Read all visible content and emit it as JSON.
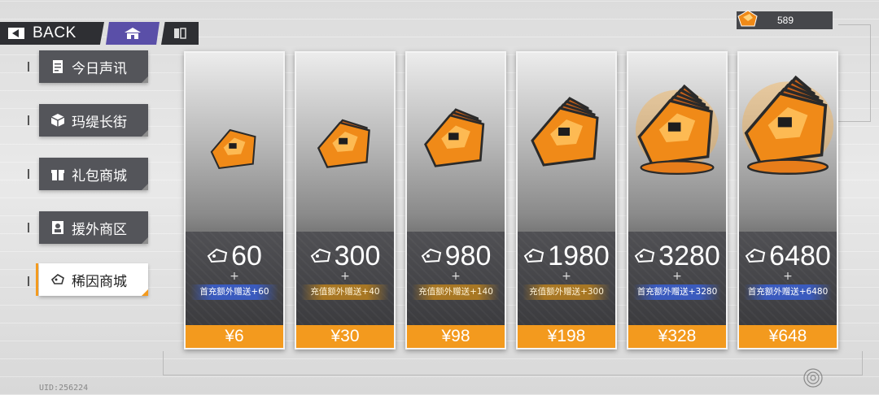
{
  "nav": {
    "back_label": "BACK"
  },
  "currency": {
    "value": "589",
    "icon": "crystal-icon"
  },
  "sidebar": {
    "items": [
      {
        "label": "今日声讯",
        "icon": "document-icon",
        "active": false
      },
      {
        "label": "玛缇长街",
        "icon": "cube-icon",
        "active": false
      },
      {
        "label": "礼包商城",
        "icon": "gift-icon",
        "active": false
      },
      {
        "label": "援外商区",
        "icon": "id-card-icon",
        "active": false
      },
      {
        "label": "稀因商城",
        "icon": "crystal-icon",
        "active": true
      }
    ]
  },
  "products": [
    {
      "amount": "60",
      "plus": "+",
      "bonus": "首充额外赠送+60",
      "bonus_type": "first",
      "price": "¥6",
      "tier": 1
    },
    {
      "amount": "300",
      "plus": "+",
      "bonus": "充值额外赠送+40",
      "bonus_type": "topup",
      "price": "¥30",
      "tier": 2
    },
    {
      "amount": "980",
      "plus": "+",
      "bonus": "充值额外赠送+140",
      "bonus_type": "topup",
      "price": "¥98",
      "tier": 3
    },
    {
      "amount": "1980",
      "plus": "+",
      "bonus": "充值额外赠送+300",
      "bonus_type": "topup",
      "price": "¥198",
      "tier": 4
    },
    {
      "amount": "3280",
      "plus": "+",
      "bonus": "首充额外赠送+3280",
      "bonus_type": "first",
      "price": "¥328",
      "tier": 5
    },
    {
      "amount": "6480",
      "plus": "+",
      "bonus": "首充额外赠送+6480",
      "bonus_type": "first",
      "price": "¥648",
      "tier": 6
    }
  ],
  "footer": {
    "uid": "UID:256224"
  },
  "colors": {
    "accent_orange": "#f39a1e",
    "nav_purple": "#5a4fa8",
    "first_bonus_blue": "#3a5cc4",
    "topup_bonus_gold": "#ad7a22"
  }
}
